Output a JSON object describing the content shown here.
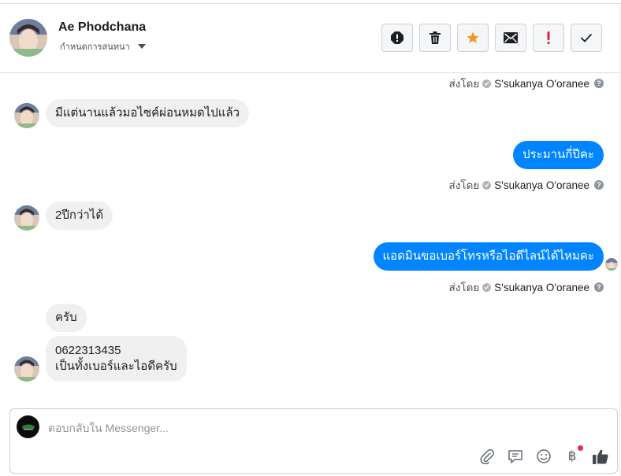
{
  "header": {
    "contact_name": "Ae Phodchana",
    "assign_label": "กำหนดการสนทนา",
    "actions": [
      {
        "name": "spam-icon",
        "color": "#1c1e21"
      },
      {
        "name": "trash-icon",
        "color": "#1c1e21"
      },
      {
        "name": "star-icon",
        "color": "#f7931e"
      },
      {
        "name": "envelope-icon",
        "color": "#1c1e21"
      },
      {
        "name": "exclamation-icon",
        "color": "#e41e3f"
      },
      {
        "name": "check-icon",
        "color": "#1c1e21"
      }
    ]
  },
  "sent_by": {
    "prefix": "ส่งโดย",
    "name": "S'sukanya O'oranee"
  },
  "messages": [
    {
      "direction": "in",
      "text": "มีแต่นานแล้วมอไซค์ผ่อนหมดไปแล้ว"
    },
    {
      "direction": "out",
      "text": "ประมานกี่ปีคะ"
    },
    {
      "direction": "in",
      "text": "2ปีกว่าได้"
    },
    {
      "direction": "out",
      "text": "แอดมินขอเบอร์โทรหรือไอดีไลน์ได้ไหมคะ"
    },
    {
      "direction": "in",
      "text": "ครับ"
    },
    {
      "direction": "in",
      "text_line1": "0622313435",
      "text_line2": "เป็นทั้งเบอร์และไอดีครับ"
    }
  ],
  "composer": {
    "placeholder": "ตอบกลับใน Messenger...",
    "value": "",
    "tools": [
      "attach-icon",
      "saved-replies-icon",
      "emoji-icon",
      "payment-icon",
      "like-icon"
    ],
    "baht_symbol": "฿",
    "accent": "#0084ff"
  }
}
